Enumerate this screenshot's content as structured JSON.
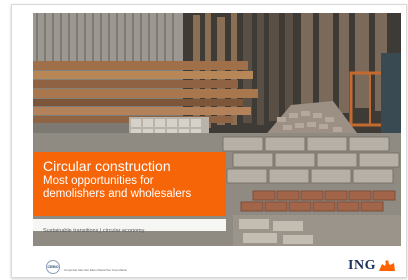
{
  "cover": {
    "title": "Circular construction",
    "headline": "Most opportunities for demolishers and wholesalers",
    "headline_line1": "Most opportunities for",
    "headline_line2": "demolishers and wholesalers",
    "subtitle": "Sustainable transitions | circular economy",
    "footer_logo_text": "CEIBO",
    "footer_caption": "Corporate Member Ellen MacArthur Foundation",
    "brand": "ING",
    "accent_color": "#ff6200",
    "photo_subject": "stacked reclaimed building materials in a salvage yard"
  }
}
